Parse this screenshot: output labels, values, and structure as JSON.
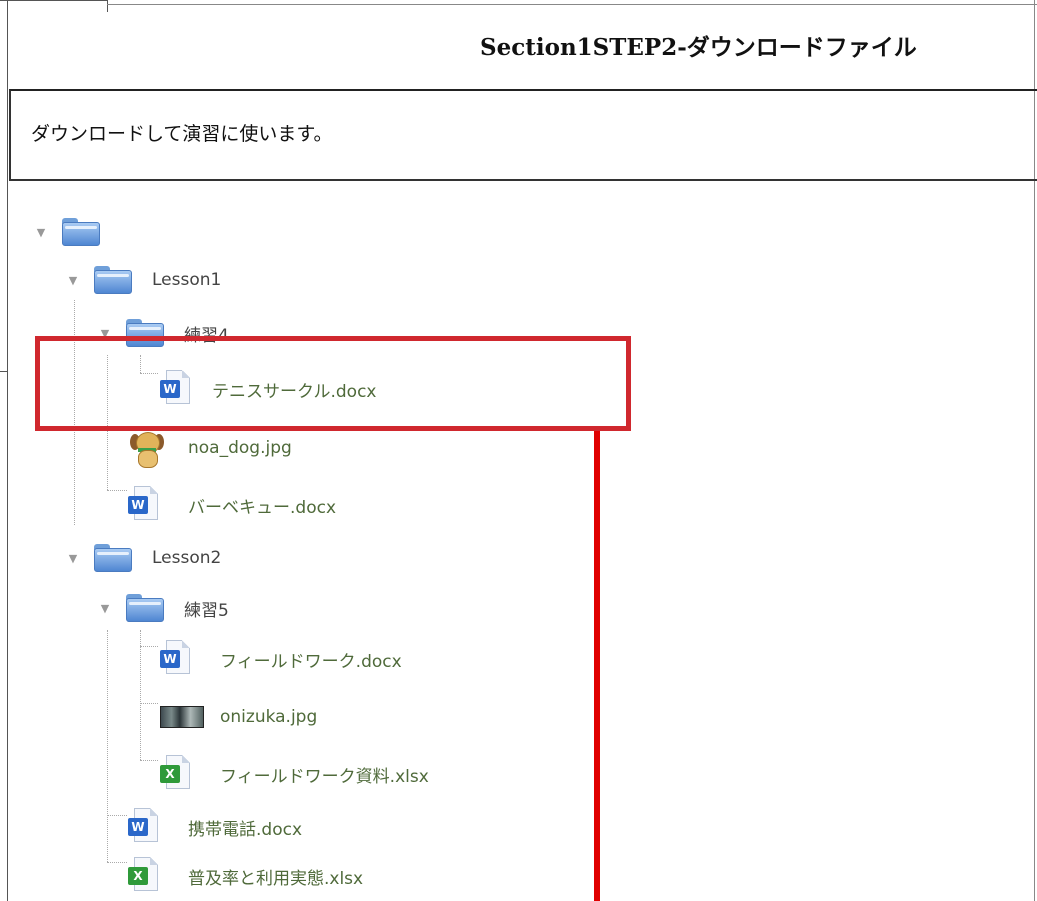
{
  "header": {
    "title": "Section1STEP2-ダウンロードファイル"
  },
  "description": "ダウンロードして演習に使います。",
  "tree": {
    "root": {
      "label": ""
    },
    "lesson1": {
      "label": "Lesson1",
      "folder": {
        "label": "練習4"
      },
      "files": {
        "tennis": "テニスサークル.docx",
        "dog": "noa_dog.jpg",
        "bbq": "バーベキュー.docx"
      }
    },
    "lesson2": {
      "label": "Lesson2",
      "folder": {
        "label": "練習5"
      },
      "files": {
        "fieldwork": "フィールドワーク.docx",
        "onizuka": "onizuka.jpg",
        "fieldwork_xlsx": "フィールドワーク資料.xlsx",
        "mobile": "携帯電話.docx",
        "usage": "普及率と利用実態.xlsx"
      }
    }
  },
  "colors": {
    "highlight": "#d0282e",
    "arrow_line": "#e00000",
    "file_label": "#4f6a3a"
  }
}
